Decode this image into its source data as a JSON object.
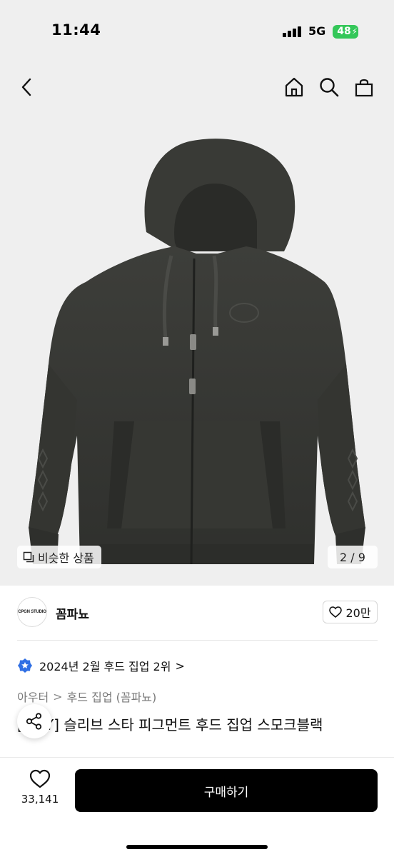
{
  "status_bar": {
    "time": "11:44",
    "network": "5G",
    "battery": "48"
  },
  "header": {
    "back_icon": "chevron-left-icon",
    "home_icon": "home-icon",
    "search_icon": "search-icon",
    "cart_icon": "shopping-bag-icon"
  },
  "gallery": {
    "similar_label": "비슷한 상품",
    "page_indicator": "2 / 9",
    "current_page": 2,
    "total_pages": 9
  },
  "brand": {
    "logo_text": "CPGN STUDIO",
    "name": "꼼파뇨",
    "like_count": "20만"
  },
  "ranking": {
    "text": "2024년 2월 후드 집업 2위",
    "chevron": ">"
  },
  "breadcrumb": {
    "category": "아우터",
    "separator": ">",
    "subcategory": "후드 집업 (꼼파뇨)"
  },
  "product": {
    "title": "[...AY] 슬리브 스타 피그먼트 후드 집업 스모크블랙"
  },
  "bottom_bar": {
    "wish_count": "33,141",
    "buy_label": "구매하기"
  },
  "colors": {
    "accent": "#000000",
    "battery": "#34c759",
    "rank_badge": "#2f6fe4",
    "hero_bg": "#efefef"
  }
}
